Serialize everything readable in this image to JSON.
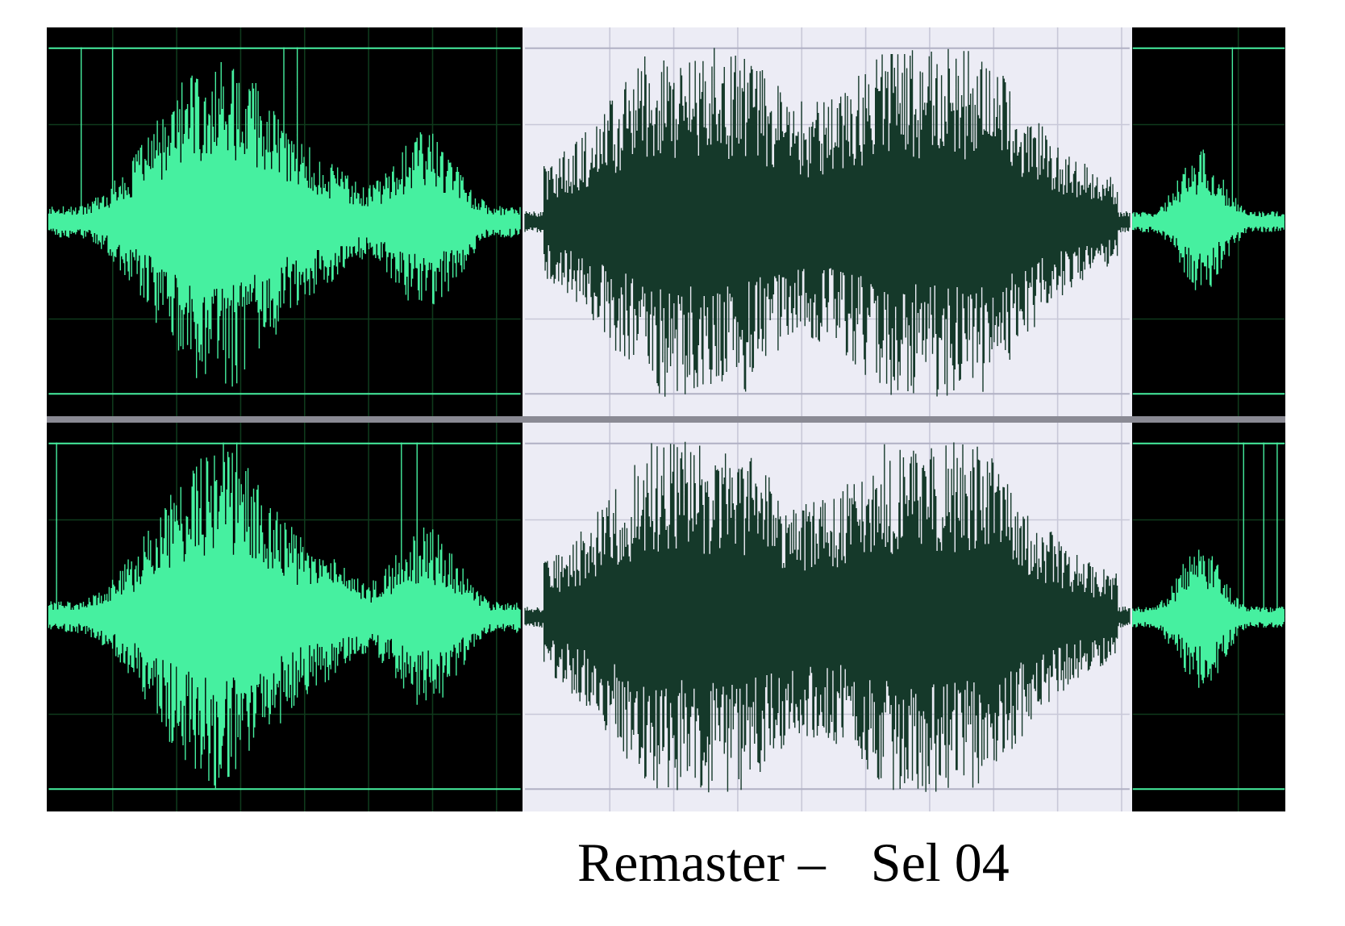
{
  "waveform": {
    "channels": [
      {
        "kind": "waveform"
      },
      {
        "kind": "waveform"
      }
    ],
    "segments": [
      {
        "selected": false
      },
      {
        "selected": true
      },
      {
        "selected": false
      }
    ]
  },
  "caption": {
    "title": "Remaster –",
    "selection": "Sel 04"
  }
}
